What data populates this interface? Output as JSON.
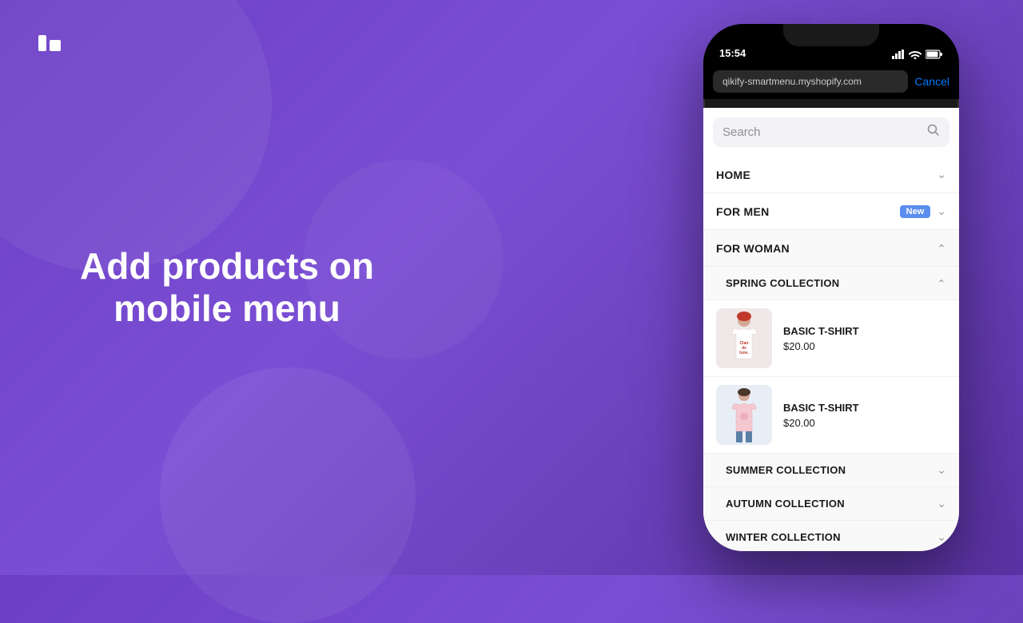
{
  "background": {
    "color_from": "#6c3fc5",
    "color_to": "#5a32a3"
  },
  "logo": {
    "alt": "Qikify logo"
  },
  "headline": {
    "line1": "Add products on",
    "line2": "mobile menu"
  },
  "phone": {
    "status_bar": {
      "time": "15:54",
      "signal_icon": "signal-icon",
      "wifi_icon": "wifi-icon",
      "battery_icon": "battery-icon"
    },
    "browser": {
      "url": "qikify-smartmenu.myshopify.com",
      "cancel_label": "Cancel"
    },
    "search": {
      "placeholder": "Search",
      "icon": "search-icon"
    },
    "menu": {
      "items": [
        {
          "label": "HOME",
          "badge": null,
          "expanded": false,
          "chevron": "down"
        },
        {
          "label": "FOR MEN",
          "badge": "New",
          "expanded": false,
          "chevron": "down"
        },
        {
          "label": "FOR WOMAN",
          "badge": null,
          "expanded": true,
          "chevron": "up",
          "subitems": [
            {
              "label": "SPRING COLLECTION",
              "expanded": true,
              "chevron": "up",
              "products": [
                {
                  "name": "BASIC T-SHIRT",
                  "price": "$20.00",
                  "image_type": "pink-tshirt"
                },
                {
                  "name": "BASIC T-SHIRT",
                  "price": "$20.00",
                  "image_type": "blue-tshirt"
                }
              ]
            },
            {
              "label": "SUMMER COLLECTION",
              "expanded": false,
              "chevron": "down"
            },
            {
              "label": "AUTUMN COLLECTION",
              "expanded": false,
              "chevron": "down"
            },
            {
              "label": "WINTER COLLECTION",
              "expanded": false,
              "chevron": "down"
            }
          ]
        }
      ]
    }
  }
}
